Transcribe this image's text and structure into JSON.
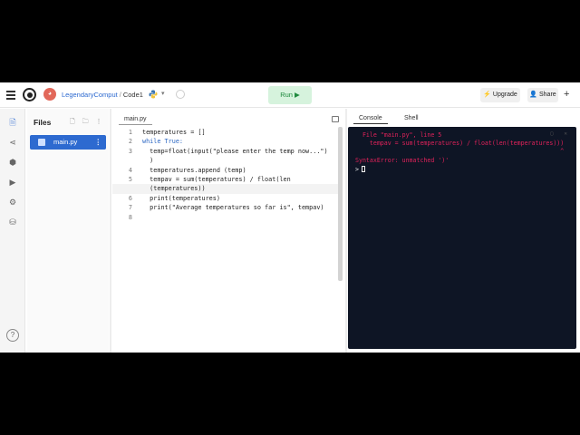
{
  "header": {
    "user": "LegendaryComput",
    "separator": "/",
    "repl_name": "Code1",
    "run_label": "Run ▶",
    "upgrade_label": "Upgrade",
    "share_label": "Share",
    "new_label": "+"
  },
  "rail": {
    "items": [
      "files-icon",
      "share-icon",
      "packages-icon",
      "debugger-icon",
      "settings-icon",
      "database-icon"
    ],
    "help_label": "?"
  },
  "files": {
    "title": "Files",
    "actions": "🗋 🗀 ⋮",
    "items": [
      {
        "name": "main.py",
        "menu": "⋮"
      }
    ]
  },
  "editor": {
    "tab": "main.py",
    "lines": [
      {
        "n": "1",
        "code": "temperatures = []"
      },
      {
        "n": "2",
        "code": "while True:"
      },
      {
        "n": "3",
        "code": "  temp=float(input(\"please enter the temp now...\")"
      },
      {
        "n": "",
        "code": "  )"
      },
      {
        "n": "4",
        "code": "  temperatures.append (temp)"
      },
      {
        "n": "5",
        "code": "  tempav = sum(temperatures) / float(len"
      },
      {
        "n": "",
        "code": "  (temperatures))"
      },
      {
        "n": "6",
        "code": "  print(temperatures)"
      },
      {
        "n": "7",
        "code": "  print(\"Average temperatures so far is\", tempav)"
      },
      {
        "n": "8",
        "code": ""
      }
    ]
  },
  "console": {
    "tabs": [
      "Console",
      "Shell"
    ],
    "lines": [
      "  File \"main.py\", line 5",
      "    tempav = sum(temperatures) / float(len(temperatures)))",
      "                                                         ^",
      "SyntaxError: unmatched ')'"
    ],
    "prompt": ">"
  }
}
